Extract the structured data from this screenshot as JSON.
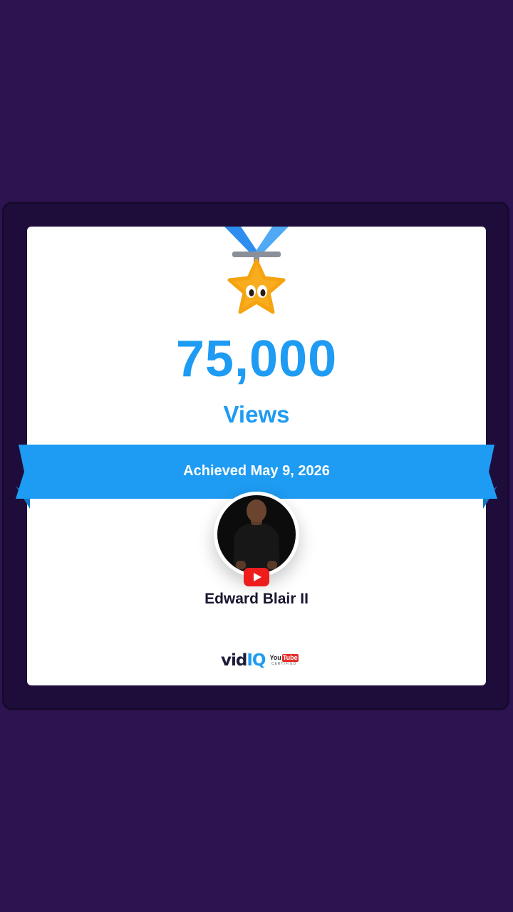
{
  "milestone": {
    "count": "75,000",
    "unit": "Views",
    "achieved": "Achieved May 9, 2026"
  },
  "channel": {
    "name": "Edward Blair II",
    "platform_icon": "youtube-icon"
  },
  "brand": {
    "prefix": "vid",
    "suffix": "IQ",
    "cert_you": "You",
    "cert_tube": "Tube",
    "cert_sub": "CERTIFIED"
  },
  "colors": {
    "background": "#2d1350",
    "accent": "#1e9bf2",
    "medal": "#f7ad1d",
    "youtube_red": "#e52d27"
  }
}
